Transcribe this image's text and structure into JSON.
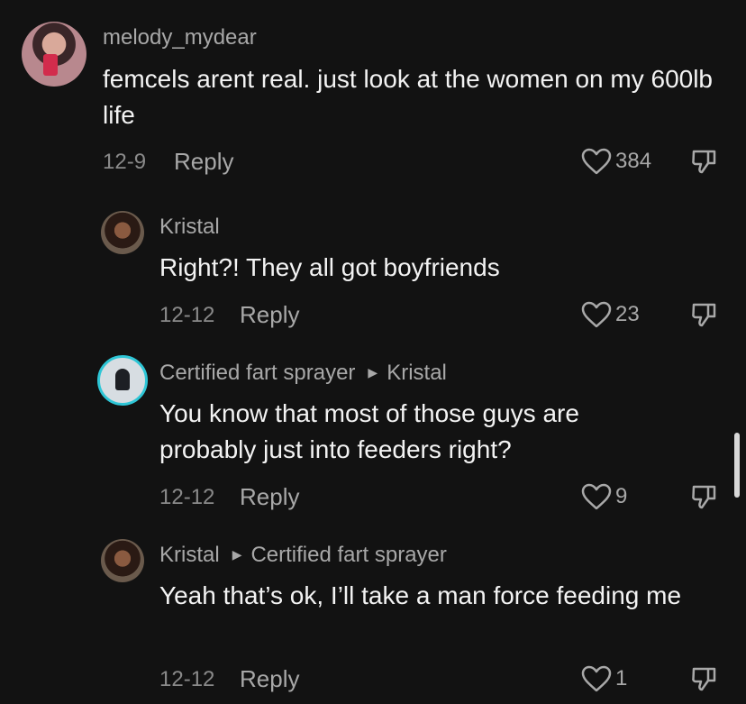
{
  "comments": [
    {
      "username": "melody_mydear",
      "text": "femcels arent real. just look at the women on my 600lb life",
      "date": "12-9",
      "reply_label": "Reply",
      "likes": "384",
      "avatar": "profile-photo"
    },
    {
      "username": "Kristal",
      "text": "Right?! They all got boyfriends",
      "date": "12-12",
      "reply_label": "Reply",
      "likes": "23",
      "avatar": "profile-photo"
    },
    {
      "username": "Certified fart sprayer",
      "reply_to": "Kristal",
      "text": "You know that most of those guys are probably just into feeders right?",
      "date": "12-12",
      "reply_label": "Reply",
      "likes": "9",
      "avatar": "profile-photo-story-ring"
    },
    {
      "username": "Kristal",
      "reply_to": "Certified fart sprayer",
      "text": "Yeah that’s ok, I’ll take a man force feeding me",
      "date": "12-12",
      "reply_label": "Reply",
      "likes": "1",
      "avatar": "profile-photo"
    }
  ],
  "icons": {
    "like": "heart-outline-icon",
    "dislike": "thumbs-down-outline-icon",
    "reply_arrow": "play-triangle-icon"
  },
  "colors": {
    "background": "#121212",
    "story_ring": "#2ec6d6"
  }
}
